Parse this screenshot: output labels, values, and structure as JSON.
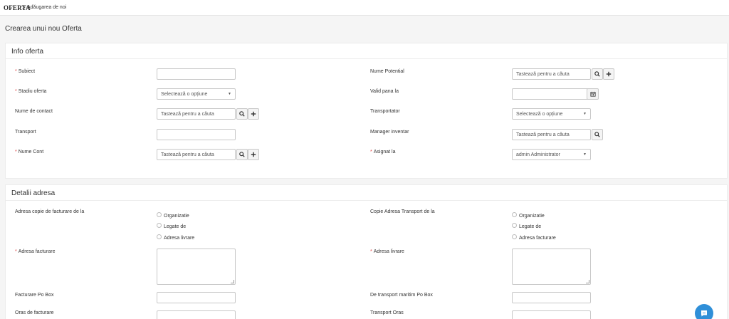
{
  "breadcrumb": {
    "module": "OFERTA",
    "separator": ">",
    "current": "Adăugarea de noi"
  },
  "page_title": "Crearea unui nou Oferta",
  "info_section": {
    "title": "Info oferta",
    "fields": {
      "subiect": {
        "label": "Subiect",
        "required": "*",
        "value": ""
      },
      "stadiu": {
        "label": "Stadiu oferta",
        "required": "*",
        "value": "Selectează o opțiune"
      },
      "contact": {
        "label": "Nume de contact",
        "placeholder": "Tastează pentru a căuta"
      },
      "transport": {
        "label": "Transport",
        "value": ""
      },
      "cont": {
        "label": "Nume Cont",
        "required": "*",
        "placeholder": "Tastează pentru a căuta"
      },
      "potential": {
        "label": "Nume Potential",
        "placeholder": "Tastează pentru a căuta"
      },
      "valid": {
        "label": "Valid pana la",
        "value": ""
      },
      "transportator": {
        "label": "Transportator",
        "value": "Selectează o opțiune"
      },
      "manager": {
        "label": "Manager inventar",
        "placeholder": "Tastează pentru a căuta"
      },
      "asignat": {
        "label": "Asignat la",
        "required": "*",
        "value": "admin Administrator"
      }
    }
  },
  "address_section": {
    "title": "Detalii adresa",
    "billing_copy": {
      "label": "Adresa copie de facturare de la",
      "options": [
        "Organizatie",
        "Legate de",
        "Adresa livrare"
      ]
    },
    "shipping_copy": {
      "label": "Copie Adresa Transport de la",
      "options": [
        "Organizatie",
        "Legate de",
        "Adresa facturare"
      ]
    },
    "adresa_facturare": {
      "label": "Adresa facturare",
      "required": "*"
    },
    "adresa_livrare": {
      "label": "Adresa livrare",
      "required": "*"
    },
    "facturare_po": {
      "label": "Facturare Po Box"
    },
    "transport_po": {
      "label": "De transport maritim Po Box"
    },
    "oras_facturare": {
      "label": "Oras de facturare"
    },
    "transport_oras": {
      "label": "Transport Oras"
    }
  },
  "icons": {
    "search": "search-icon",
    "add": "plus-icon",
    "calendar": "calendar-icon",
    "chat": "chat-icon"
  },
  "colors": {
    "required": "#e04040",
    "chat_button": "#2f8fd8"
  }
}
